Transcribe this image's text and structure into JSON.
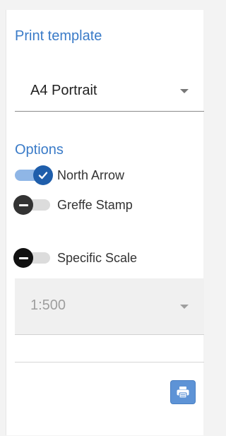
{
  "print_template": {
    "title": "Print template",
    "selected": "A4 Portrait"
  },
  "options": {
    "title": "Options",
    "toggles": [
      {
        "label": "North Arrow",
        "checked": true
      },
      {
        "label": "Greffe Stamp",
        "checked": false
      },
      {
        "label": "Specific Scale",
        "checked": false
      }
    ]
  },
  "scale": {
    "selected": "1:500",
    "disabled": true
  },
  "actions": {
    "print_icon": "printer-icon"
  },
  "colors": {
    "accent": "#3a7bc8",
    "toggle_on_knob": "#1f5eab",
    "toggle_on_track": "#8fb6e6",
    "button": "#5d93d6"
  }
}
